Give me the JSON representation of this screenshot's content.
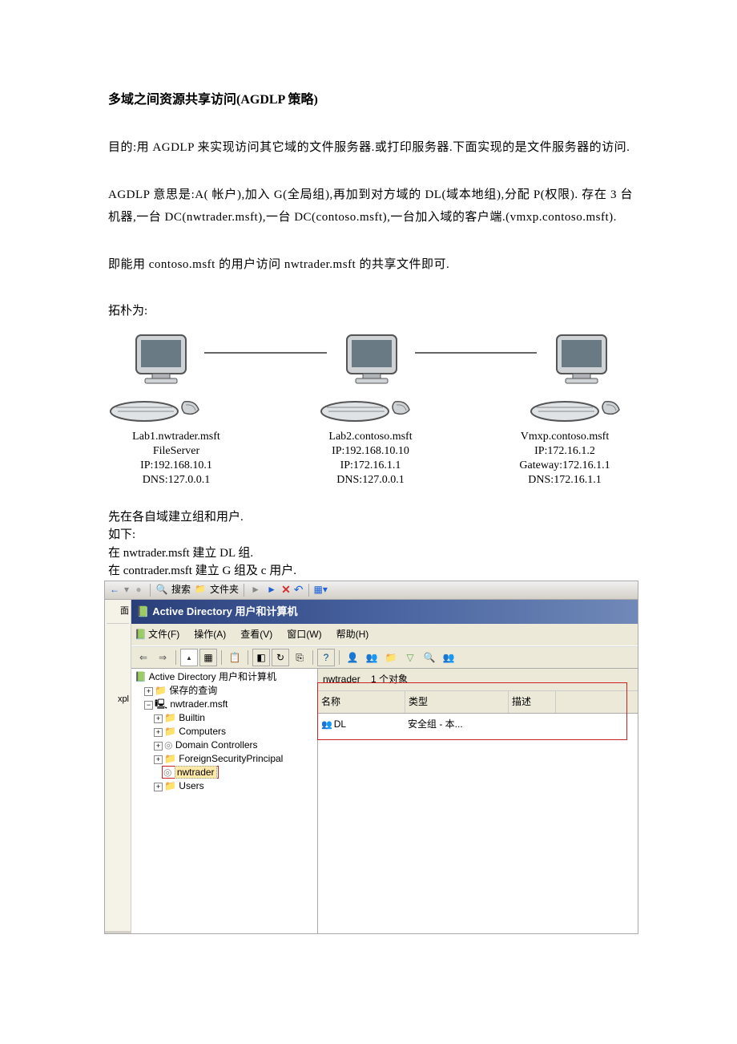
{
  "title": "多域之间资源共享访问(AGDLP 策略)",
  "para1": "目的:用 AGDLP 来实现访问其它域的文件服务器.或打印服务器.下面实现的是文件服务器的访问.",
  "para2": "AGDLP 意思是:A( 帐户),加入 G(全局组),再加到对方域的 DL(域本地组),分配 P(权限). 存在 3 台机器,一台 DC(nwtrader.msft),一台 DC(contoso.msft),一台加入域的客户端.(vmxp.contoso.msft).",
  "para3": "即能用 contoso.msft 的用户访问 nwtrader.msft 的共享文件即可.",
  "topo_label": "拓朴为:",
  "pcs": [
    {
      "name": "Lab1.nwtrader.msft",
      "l1": "FileServer",
      "l2": "IP:192.168.10.1",
      "l3": "DNS:127.0.0.1",
      "l4": ""
    },
    {
      "name": "Lab2.contoso.msft",
      "l1": "IP:192.168.10.10",
      "l2": "IP:172.16.1.1",
      "l3": "DNS:127.0.0.1",
      "l4": ""
    },
    {
      "name": "Vmxp.contoso.msft",
      "l1": "IP:172.16.1.2",
      "l2": "Gateway:172.16.1.1",
      "l3": "DNS:172.16.1.1",
      "l4": ""
    }
  ],
  "pre_ss_1": "先在各自域建立组和用户.",
  "pre_ss_2": "如下:",
  "pre_ss_3": "在 nwtrader.msft 建立 DL 组.",
  "pre_ss_4": "在 contrader.msft 建立 G 组及 c 用户.",
  "top_toolbar": {
    "search": "搜索",
    "folders": "文件夹"
  },
  "side_stub": {
    "line1": "面",
    "line2": "xpl"
  },
  "mmc": {
    "title": "Active Directory 用户和计算机",
    "menu": {
      "file": "文件(F)",
      "action": "操作(A)",
      "view": "查看(V)",
      "window": "窗口(W)",
      "help": "帮助(H)"
    },
    "tree": {
      "root": "Active Directory 用户和计算机",
      "saved": "保存的查询",
      "domain": "nwtrader.msft",
      "n1": "Builtin",
      "n2": "Computers",
      "n3": "Domain Controllers",
      "n4": "ForeignSecurityPrincipal",
      "n5": "nwtrader",
      "n6": "Users"
    },
    "list": {
      "path": "nwtrader",
      "count": "1 个对象",
      "col_name": "名称",
      "col_type": "类型",
      "col_desc": "描述",
      "row1_name": "DL",
      "row1_type": "安全组 - 本..."
    }
  }
}
